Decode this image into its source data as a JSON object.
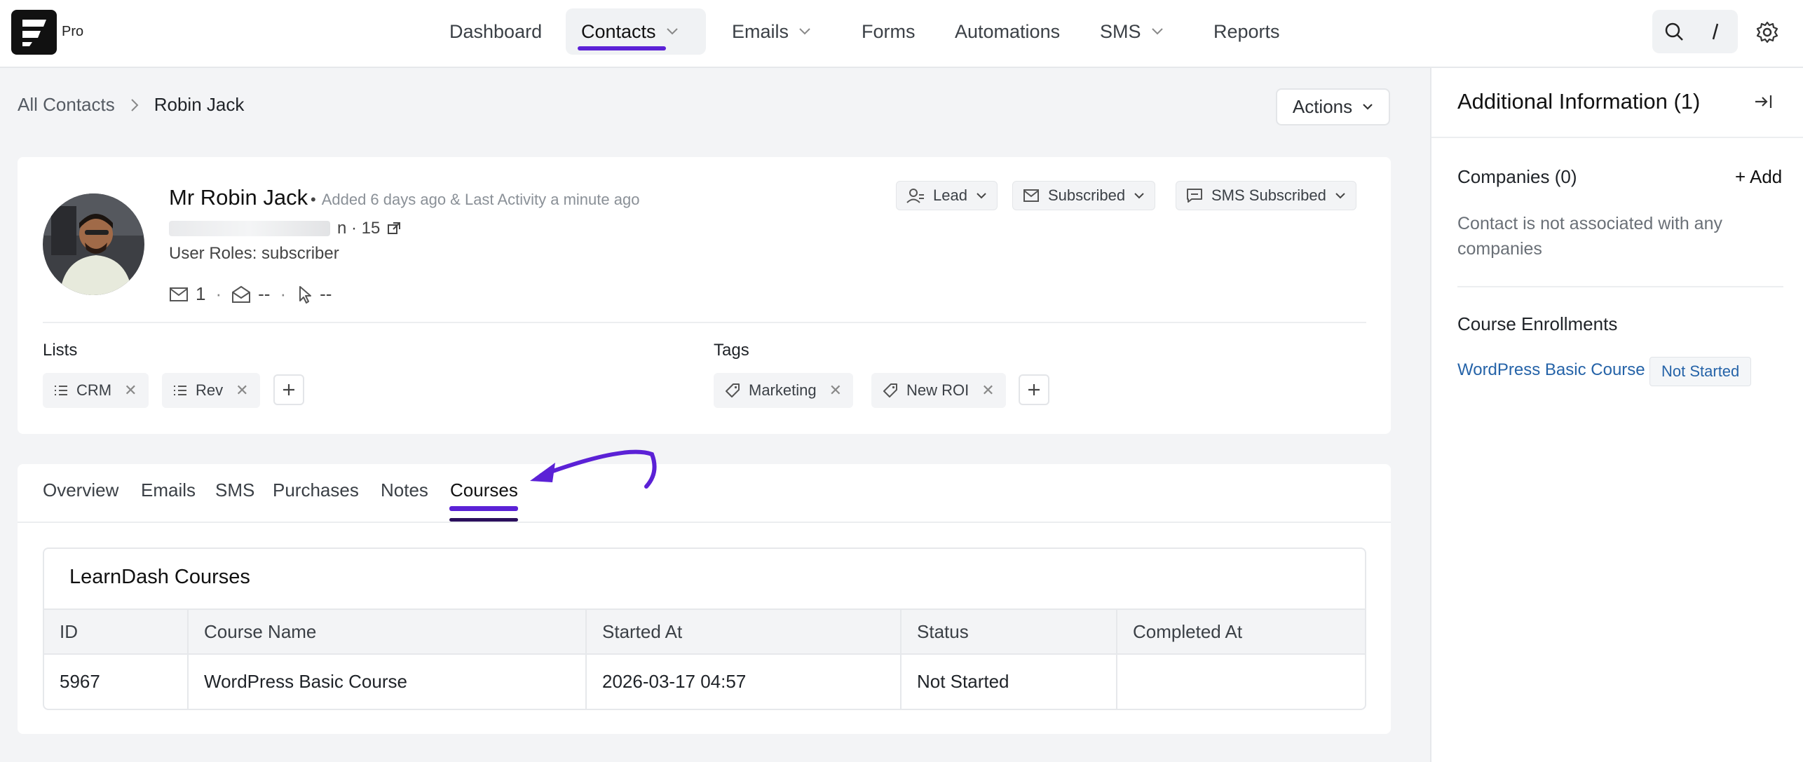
{
  "brand": {
    "badge": "Pro"
  },
  "nav": {
    "items": [
      {
        "label": "Dashboard"
      },
      {
        "label": "Contacts"
      },
      {
        "label": "Emails"
      },
      {
        "label": "Forms"
      },
      {
        "label": "Automations"
      },
      {
        "label": "SMS"
      },
      {
        "label": "Reports"
      }
    ],
    "active": "Contacts"
  },
  "breadcrumb": {
    "root": "All Contacts",
    "current": "Robin Jack"
  },
  "actions_label": "Actions",
  "contact": {
    "name": "Mr Robin Jack",
    "added": "Added 6 days ago & Last Activity a minute ago",
    "email_suffix": "n · 15",
    "roles": "User Roles: subscriber",
    "stats": {
      "emails": "1",
      "opens": "--",
      "clicks": "--"
    },
    "status_pills": [
      {
        "label": "Lead",
        "icon": "user-icon"
      },
      {
        "label": "Subscribed",
        "icon": "mail-icon"
      },
      {
        "label": "SMS Subscribed",
        "icon": "message-icon"
      }
    ]
  },
  "lists": {
    "label": "Lists",
    "items": [
      "CRM",
      "Rev"
    ]
  },
  "tags": {
    "label": "Tags",
    "items": [
      "Marketing",
      "New ROI"
    ]
  },
  "tabs": [
    {
      "label": "Overview"
    },
    {
      "label": "Emails"
    },
    {
      "label": "SMS"
    },
    {
      "label": "Purchases"
    },
    {
      "label": "Notes"
    },
    {
      "label": "Courses"
    }
  ],
  "active_tab": "Courses",
  "courses": {
    "title": "LearnDash Courses",
    "columns": [
      "ID",
      "Course Name",
      "Started At",
      "Status",
      "Completed At"
    ],
    "rows": [
      [
        "5967",
        "WordPress Basic Course",
        "2026-03-17 04:57",
        "Not Started",
        ""
      ]
    ]
  },
  "sidebar": {
    "title": "Additional Information (1)",
    "companies_label": "Companies (0)",
    "add_label": "+ Add",
    "companies_empty": "Contact is not associated with any companies",
    "enrollments_label": "Course Enrollments",
    "enrollment": {
      "course": "WordPress Basic Course",
      "status": "Not Started"
    }
  },
  "colors": {
    "accent": "#5b21d6",
    "link": "#2563a8"
  }
}
